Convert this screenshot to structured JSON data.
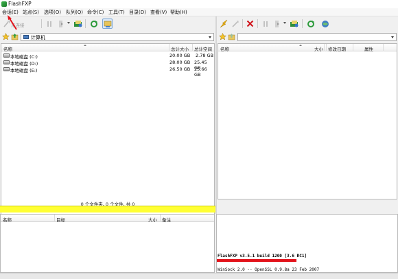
{
  "window": {
    "title": "FlashFXP"
  },
  "menu": [
    {
      "label": "会话(E)"
    },
    {
      "label": "站点(S)"
    },
    {
      "label": "选项(O)"
    },
    {
      "label": "队列(Q)"
    },
    {
      "label": "命令(C)"
    },
    {
      "label": "工具(T)"
    },
    {
      "label": "目录(D)"
    },
    {
      "label": "查看(V)"
    },
    {
      "label": "帮助(H)"
    }
  ],
  "left_pane": {
    "toolbar": {
      "disconnected_label": "未连接"
    },
    "path": "计算机",
    "columns": {
      "name": "名称",
      "total_size": "总计大小",
      "free_space": "总计空间"
    },
    "drives": [
      {
        "name": "本地磁盘 (C:)",
        "total": "20.00 GB",
        "free": "2.78 GB"
      },
      {
        "name": "本地磁盘 (D:)",
        "total": "28.00 GB",
        "free": "25.45 GB"
      },
      {
        "name": "本地磁盘 (E:)",
        "total": "26.50 GB",
        "free": "25.66 GB"
      }
    ],
    "status": "0 个文件夹, 0 个文件, 共 0"
  },
  "right_pane": {
    "path": "",
    "columns": {
      "name": "名称",
      "size": "大小",
      "modified": "修改日期",
      "attributes": "属性"
    }
  },
  "queue": {
    "columns": {
      "name": "名称",
      "target": "目标",
      "size": "大小",
      "note": "备注"
    }
  },
  "log": {
    "lines": [
      "FlashFXP v3.5.1 build 1200 [3.6 RC1]",
      "WinSock 2.0 -- OpenSSL 0.9.8a 23 Feb 2007"
    ]
  },
  "icons": {
    "favorite": "star-icon",
    "up_folder": "up-folder-icon",
    "computer": "computer-icon",
    "drive": "hard-drive-icon"
  },
  "colors": {
    "status_highlight": "#ffff33",
    "annotation_red": "#e3131b"
  }
}
